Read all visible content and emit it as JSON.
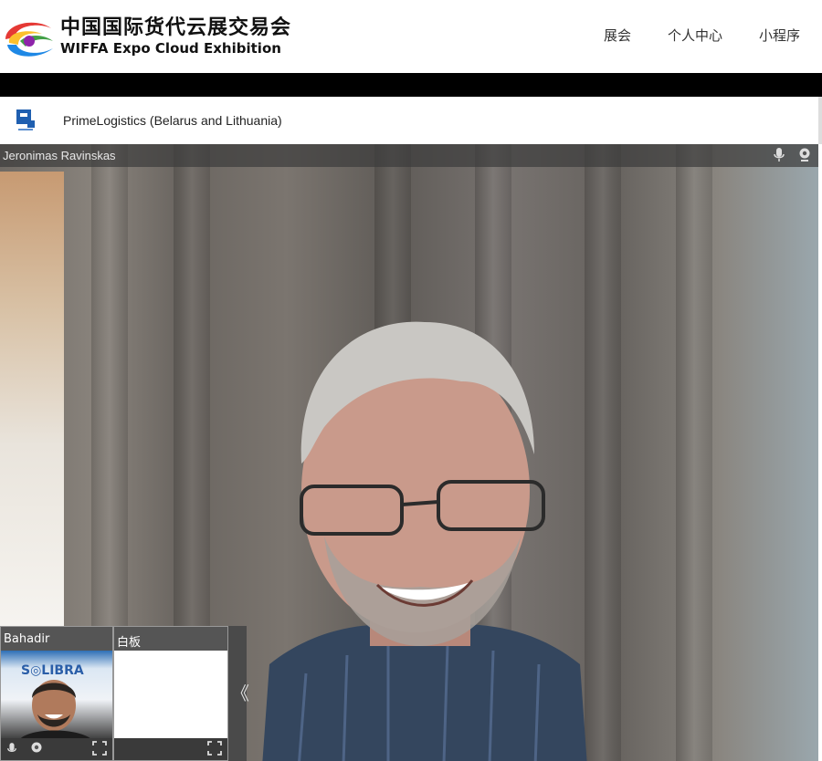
{
  "header": {
    "logo_cn": "中国国际货代云展交易会",
    "logo_en": "WIFFA Expo Cloud Exhibition",
    "nav": [
      {
        "label": "展会"
      },
      {
        "label": "个人中心"
      },
      {
        "label": "小程序"
      }
    ]
  },
  "company": {
    "name": "PrimeLogistics (Belarus and Lithuania)"
  },
  "main_video": {
    "speaker": "Jeronimas Ravinskas"
  },
  "thumbnails": [
    {
      "label": "Bahadir"
    },
    {
      "label": "白板"
    }
  ],
  "colors": {
    "nav_text": "#333333",
    "black_bar": "#000000",
    "thumb_header": "#555555"
  }
}
